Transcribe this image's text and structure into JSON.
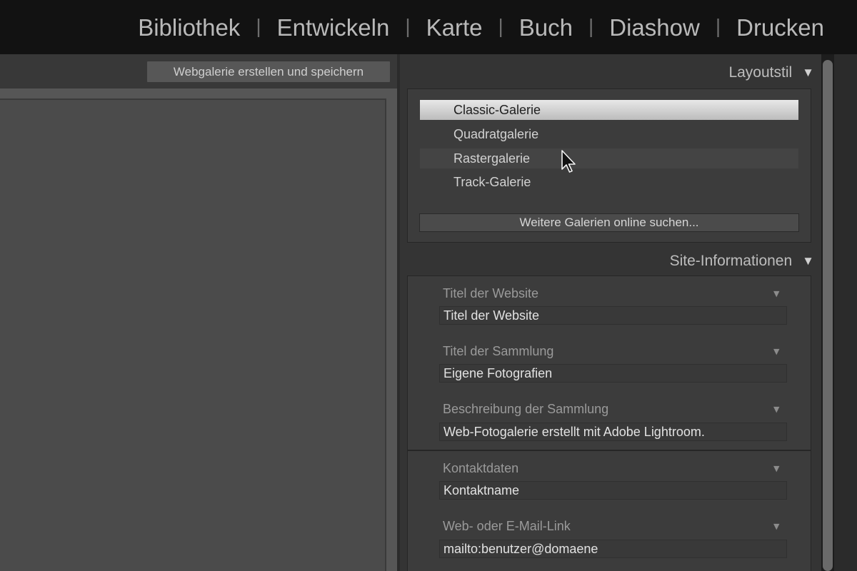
{
  "modules": [
    {
      "label": "Bibliothek"
    },
    {
      "label": "Entwickeln"
    },
    {
      "label": "Karte"
    },
    {
      "label": "Buch"
    },
    {
      "label": "Diashow"
    },
    {
      "label": "Drucken"
    }
  ],
  "module_separator": "|",
  "toolbar": {
    "create_save_label": "Webgalerie erstellen und speichern"
  },
  "layout_panel": {
    "title": "Layoutstil",
    "collapse_icon": "triangle-down-icon",
    "galleries": [
      {
        "label": "Classic-Galerie",
        "selected": true
      },
      {
        "label": "Quadratgalerie"
      },
      {
        "label": "Rastergalerie"
      },
      {
        "label": "Track-Galerie"
      }
    ],
    "more_button": "Weitere Galerien online suchen..."
  },
  "site_panel": {
    "title": "Site-Informationen",
    "collapse_icon": "triangle-down-icon",
    "fields": [
      {
        "label": "Titel der Website",
        "value": "Titel der Website"
      },
      {
        "label": "Titel der Sammlung",
        "value": "Eigene Fotografien"
      },
      {
        "label": "Beschreibung der Sammlung",
        "value": "Web-Fotogalerie erstellt mit Adobe Lightroom."
      },
      {
        "label": "Kontaktdaten",
        "value": "Kontaktname"
      },
      {
        "label": "Web- oder E-Mail-Link",
        "value": "mailto:benutzer@domaene"
      }
    ]
  },
  "icons": {
    "collapse": "▼",
    "field_dropdown": "▼",
    "cursor": "mouse-pointer-icon"
  }
}
